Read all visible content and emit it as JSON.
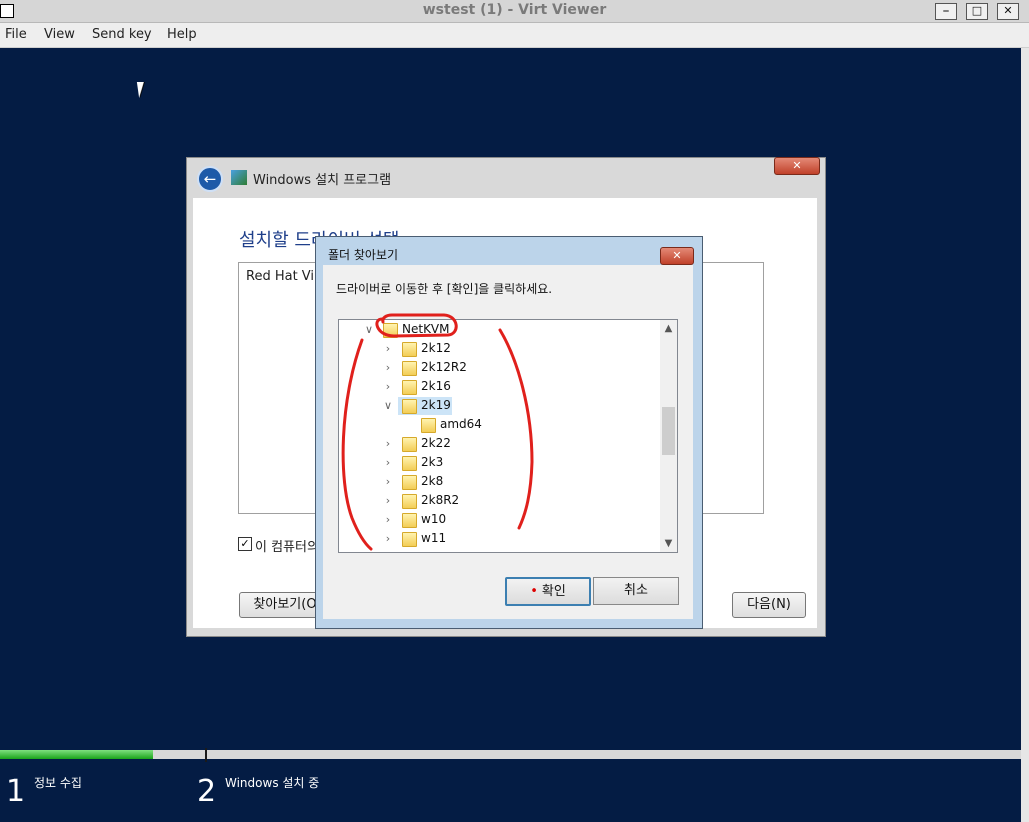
{
  "window": {
    "title": "wstest (1) - Virt Viewer"
  },
  "menu": {
    "items": [
      "File",
      "View",
      "Send key",
      "Help"
    ]
  },
  "setup": {
    "title": "Windows 설치 프로그램",
    "heading": "설치할 드라이버 선택",
    "driver_item": "Red Hat VirtI",
    "checkbox_label": "이 컴퓨터의",
    "browse_label": "찾아보기(O",
    "next_label": "다음(N)"
  },
  "dialog": {
    "title": "폴더 찾아보기",
    "instruction": "드라이버로 이동한 후 [확인]을 클릭하세요.",
    "tree": [
      {
        "label": "NetKVM",
        "expanded": true,
        "level": 0
      },
      {
        "label": "2k12",
        "expanded": false,
        "level": 1
      },
      {
        "label": "2k12R2",
        "expanded": false,
        "level": 1
      },
      {
        "label": "2k16",
        "expanded": false,
        "level": 1
      },
      {
        "label": "2k19",
        "expanded": true,
        "level": 1,
        "selected": true
      },
      {
        "label": "amd64",
        "expanded": false,
        "level": 2
      },
      {
        "label": "2k22",
        "expanded": false,
        "level": 1
      },
      {
        "label": "2k3",
        "expanded": false,
        "level": 1
      },
      {
        "label": "2k8",
        "expanded": false,
        "level": 1
      },
      {
        "label": "2k8R2",
        "expanded": false,
        "level": 1
      },
      {
        "label": "w10",
        "expanded": false,
        "level": 1
      },
      {
        "label": "w11",
        "expanded": false,
        "level": 1
      }
    ],
    "ok_label": "확인",
    "cancel_label": "취소"
  },
  "footer": {
    "progress": 0.15,
    "steps": [
      {
        "num": "1",
        "label": "정보 수집"
      },
      {
        "num": "2",
        "label": "Windows 설치 중"
      }
    ]
  },
  "colors": {
    "desktop": "#041c44",
    "accent": "#3c7fb1",
    "progress": "#1aa31a",
    "annotation": "#e0201c"
  }
}
